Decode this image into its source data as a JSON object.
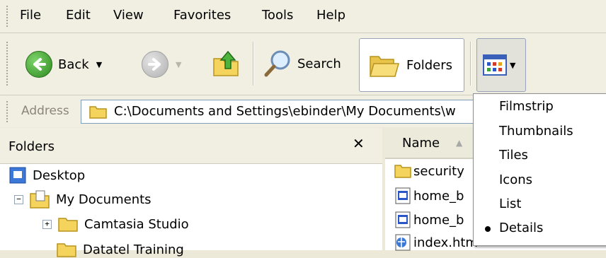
{
  "menu": {
    "items": [
      {
        "label": "File"
      },
      {
        "label": "Edit"
      },
      {
        "label": "View"
      },
      {
        "label": "Favorites"
      },
      {
        "label": "Tools"
      },
      {
        "label": "Help"
      }
    ]
  },
  "toolbar": {
    "back_label": "Back",
    "search_label": "Search",
    "folders_label": "Folders"
  },
  "address": {
    "label": "Address",
    "value": "C:\\Documents and Settings\\ebinder\\My Documents\\w"
  },
  "folders_pane": {
    "title": "Folders",
    "close_glyph": "✕",
    "tree": [
      {
        "label": "Desktop",
        "expander": ""
      },
      {
        "label": "My Documents",
        "expander": "−"
      },
      {
        "label": "Camtasia Studio",
        "expander": "+"
      },
      {
        "label": "Datatel Training",
        "expander": ""
      }
    ]
  },
  "file_list": {
    "column_name": "Name",
    "sort_glyph": "▲",
    "files": [
      {
        "name": "security",
        "icon": "folder-icon"
      },
      {
        "name": "home_b",
        "icon": "html-file-icon"
      },
      {
        "name": "home_b",
        "icon": "html-file-icon"
      },
      {
        "name": "index.htm",
        "icon": "web-page-icon"
      }
    ]
  },
  "view_menu": {
    "items": [
      {
        "label": "Filmstrip",
        "selected": false
      },
      {
        "label": "Thumbnails",
        "selected": false
      },
      {
        "label": "Tiles",
        "selected": false
      },
      {
        "label": "Icons",
        "selected": false
      },
      {
        "label": "List",
        "selected": false
      },
      {
        "label": "Details",
        "selected": true
      }
    ]
  },
  "colors": {
    "chrome": "#ECE9D8",
    "back_green": "#3A9B2B",
    "folder_yellow": "#F5D45E"
  }
}
